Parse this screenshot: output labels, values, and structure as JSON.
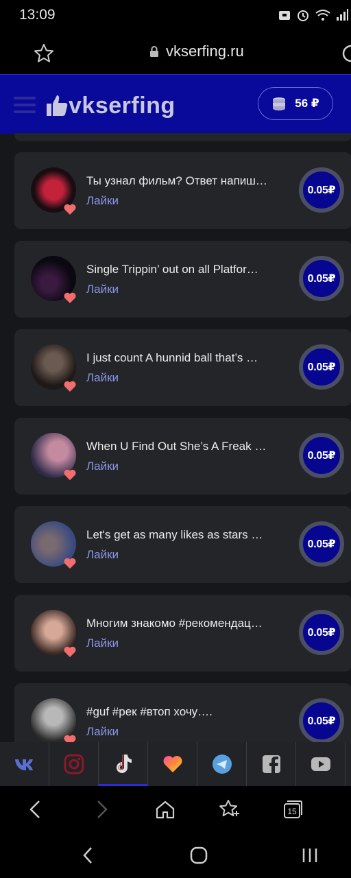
{
  "status": {
    "time": "13:09"
  },
  "browser": {
    "url": "vkserfing.ru",
    "tab_count": "15"
  },
  "header": {
    "logo": "vkserfing",
    "balance": "56 ₽"
  },
  "tasks": [
    {
      "title": "Ты узнал фильм? Ответ напиш…",
      "type": "Лайки",
      "price": "0.05₽",
      "avatar_color": "#7a2030"
    },
    {
      "title": "Single Trippin’ out on all Platfor…",
      "type": "Лайки",
      "price": "0.05₽",
      "avatar_color": "#1c1020"
    },
    {
      "title": "I just count A hunnid ball that’s …",
      "type": "Лайки",
      "price": "0.05₽",
      "avatar_color": "#3a3430"
    },
    {
      "title": "When U Find Out She’s A Freak …",
      "type": "Лайки",
      "price": "0.05₽",
      "avatar_color": "#7a5068"
    },
    {
      "title": "Let's get as many likes as stars …",
      "type": "Лайки",
      "price": "0.05₽",
      "avatar_color": "#4a4a60"
    },
    {
      "title": "Многим знакомо #рекомендац…",
      "type": "Лайки",
      "price": "0.05₽",
      "avatar_color": "#6a4a44"
    },
    {
      "title": "#guf #рек #втоп хочу….",
      "type": "Лайки",
      "price": "0.05₽",
      "avatar_color": "#8a8a8a"
    }
  ],
  "social_tabs": [
    {
      "name": "vk",
      "icon": "vk-icon"
    },
    {
      "name": "instagram",
      "icon": "instagram-icon"
    },
    {
      "name": "tiktok",
      "icon": "tiktok-icon",
      "active": true
    },
    {
      "name": "likee",
      "icon": "heart-gradient-icon"
    },
    {
      "name": "telegram",
      "icon": "telegram-icon"
    },
    {
      "name": "facebook",
      "icon": "facebook-icon"
    },
    {
      "name": "youtube",
      "icon": "youtube-icon"
    }
  ],
  "colors": {
    "header_bg": "#0a0a9a",
    "accent_link": "#8b95e8",
    "card_bg": "#242528",
    "heart": "#f26d6d"
  }
}
